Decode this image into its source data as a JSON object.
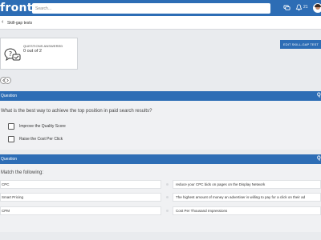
{
  "app": {
    "logo_text": "front",
    "search_placeholder": "Search..."
  },
  "topbar": {
    "notification_count": "21"
  },
  "breadcrumb": {
    "title": "Skill-gap tests"
  },
  "progress_card": {
    "label": "QUESTIONS ANSWERED",
    "value": "0 out of 2"
  },
  "actions": {
    "edit_label": "EDIT SKILL-GAP TEST"
  },
  "question1": {
    "header": "Question",
    "text": "What is the best way to achieve the top position in paid search results?",
    "options": [
      {
        "label": "Improve the Quality Score",
        "checked": false
      },
      {
        "label": "Raise the Cost Per Click",
        "checked": false
      }
    ]
  },
  "question2": {
    "header": "Question",
    "text": "Match the following:",
    "left_items": [
      "CPC",
      "Smart Pricing",
      "CPM"
    ],
    "right_items": [
      "reduce your CPC bids on pages on the Display Network",
      "The highest amount of money an advertiser is willing to pay for a click on their ad",
      "Cost Per Thousand Impressions"
    ]
  },
  "colors": {
    "brand_blue": "#2d6db5",
    "background": "#e9ebee"
  },
  "icons": [
    "chat-icon",
    "bell-icon",
    "avatar",
    "back-arrow-icon",
    "question-bubbles-icon",
    "prev-circle-icon",
    "next-circle-icon"
  ]
}
